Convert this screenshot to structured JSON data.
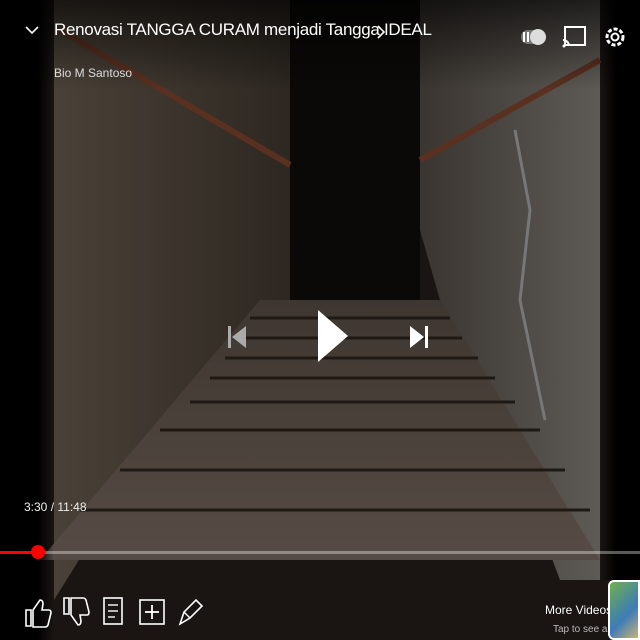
{
  "video": {
    "title": "Renovasi TANGGA CURAM menjadi Tangga IDEAL",
    "channel": "Bio M Santoso",
    "time_current": "3:30",
    "time_total": "11:48",
    "time_display": "3:30 / 11:48",
    "progress_fraction": 0.06
  },
  "top_controls": {
    "collapse_icon": "chevron-down-icon",
    "title_more_icon": "chevron-right-icon",
    "toggle_icon": "pause-toggle-icon",
    "cast_icon": "cast-icon",
    "settings_icon": "gear-icon"
  },
  "center_controls": {
    "previous_icon": "skip-previous-icon",
    "play_icon": "play-icon",
    "next_icon": "skip-next-icon"
  },
  "bottom_actions": [
    {
      "icon": "thumbs-up-icon"
    },
    {
      "icon": "thumbs-down-icon"
    },
    {
      "icon": "comments-icon"
    },
    {
      "icon": "save-icon"
    },
    {
      "icon": "share-icon"
    }
  ],
  "more_videos": {
    "label": "More Videos",
    "sub": "Tap to see all"
  },
  "colors": {
    "accent": "#ff0000"
  }
}
